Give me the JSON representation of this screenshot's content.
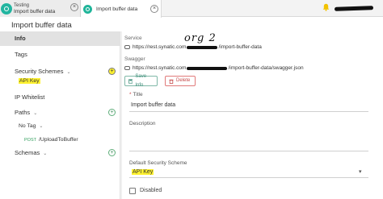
{
  "tabs": [
    {
      "subtitle": "Testing",
      "title": "Import buffer data",
      "close": "×"
    },
    {
      "title": "Import buffer data",
      "close": "×"
    }
  ],
  "page": {
    "title": "Import buffer data"
  },
  "sidebar": {
    "items": [
      {
        "label": "Info",
        "active": true
      },
      {
        "label": "Tags"
      },
      {
        "label": "Security Schemes",
        "chevron": "⌄",
        "action": "+"
      },
      {
        "label": "API Key",
        "highlight": true
      },
      {
        "label": "IP Whitelist"
      },
      {
        "label": "Paths",
        "chevron": "⌄",
        "action": "+"
      },
      {
        "label": "No Tag",
        "chevron": "⌄"
      },
      {
        "method": "POST",
        "label": "/UploadToBuffer"
      },
      {
        "label": "Schemas",
        "chevron": "⌄",
        "action": "+"
      }
    ]
  },
  "main": {
    "service_label": "Service",
    "service_url_prefix": "https://rest.synatic.com",
    "service_url_suffix": "/import-buffer-data",
    "handwritten_note": "org 2",
    "swagger_label": "Swagger",
    "swagger_url_prefix": "https://rest.synatic.com",
    "swagger_url_suffix": "/import-buffer-data/swagger.json",
    "save_label": "Save Info",
    "delete_label": "Delete",
    "title_label": "Title",
    "title_value": "Import buffer data",
    "description_label": "Description",
    "security_label": "Default Security Scheme",
    "security_value": "API Key",
    "disabled_label": "Disabled"
  },
  "colors": {
    "accent_green": "#22b5a0",
    "highlight_yellow": "#fff230",
    "delete_red": "#c64b4b"
  }
}
